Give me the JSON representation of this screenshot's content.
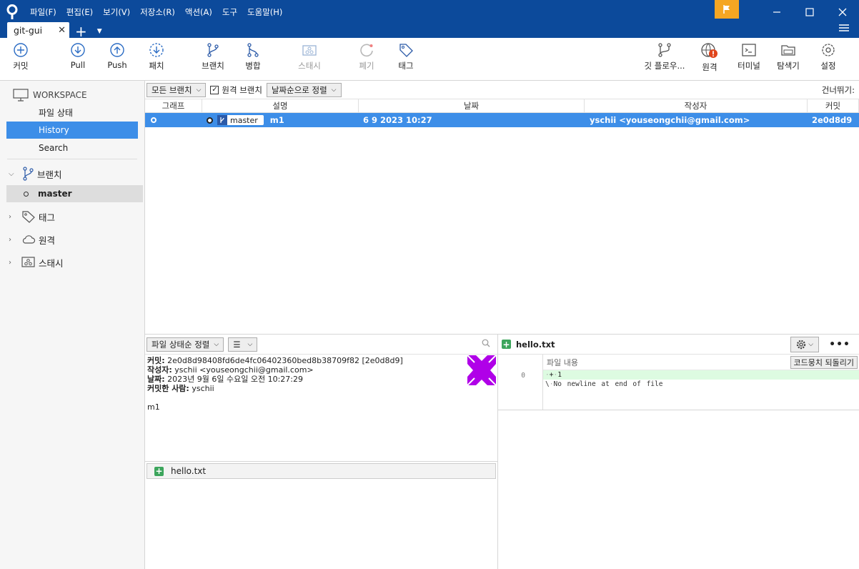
{
  "menu": [
    "파일(F)",
    "편집(E)",
    "보기(V)",
    "저장소(R)",
    "액션(A)",
    "도구",
    "도움말(H)"
  ],
  "tab": {
    "label": "git-gui"
  },
  "toolbar": {
    "commit": "커밋",
    "pull": "Pull",
    "push": "Push",
    "patch": "패치",
    "branch": "브랜치",
    "merge": "병합",
    "stash": "스태시",
    "discard": "폐기",
    "tag": "태그",
    "gitflow": "깃 플로우...",
    "remote": "원격",
    "terminal": "터미널",
    "explorer": "탐색기",
    "settings": "설정"
  },
  "sidebar": {
    "workspace": "WORKSPACE",
    "items": [
      "파일 상태",
      "History",
      "Search"
    ],
    "branches": "브랜치",
    "branch_master": "master",
    "tags": "태그",
    "remotes": "원격",
    "stashes": "스태시"
  },
  "filter": {
    "all_branches": "모든 브랜치",
    "remote_branches": "원격 브랜치",
    "sort": "날짜순으로 정렬",
    "skip": "건너뛰기:"
  },
  "table": {
    "headers": [
      "그래프",
      "설명",
      "날짜",
      "작성자",
      "커밋"
    ],
    "rows": [
      {
        "branch": "master",
        "message": "m1",
        "date": "6 9 2023 10:27",
        "author": "yschii <youseongchii@gmail.com>",
        "commit": "2e0d8d9"
      }
    ]
  },
  "details": {
    "sort": "파일 상태순 정렬",
    "commit_label": "커밋:",
    "commit_value": "2e0d8d98408fd6de4fc06402360bed8b38709f82 [2e0d8d9]",
    "author_label": "작성자:",
    "author_value": "yschii <youseongchii@gmail.com>",
    "date_label": "날짜:",
    "date_value": "2023년 9월 6일 수요일 오전 10:27:29",
    "committer_label": "커밋한 사람:",
    "committer_value": "yschii",
    "message": "m1",
    "file": "hello.txt"
  },
  "diff": {
    "file": "hello.txt",
    "header": "파일 내용",
    "revert_hunk": "코드뭉치 되돌리기",
    "line_no": "0",
    "added_line": "1",
    "no_newline": "No newline at end of file"
  },
  "colors": {
    "titlebar": "#0c4a9b",
    "selection": "#3d8ee8",
    "flag": "#f5a623",
    "added": "#3ca55c",
    "avatar": "#b000e8"
  }
}
